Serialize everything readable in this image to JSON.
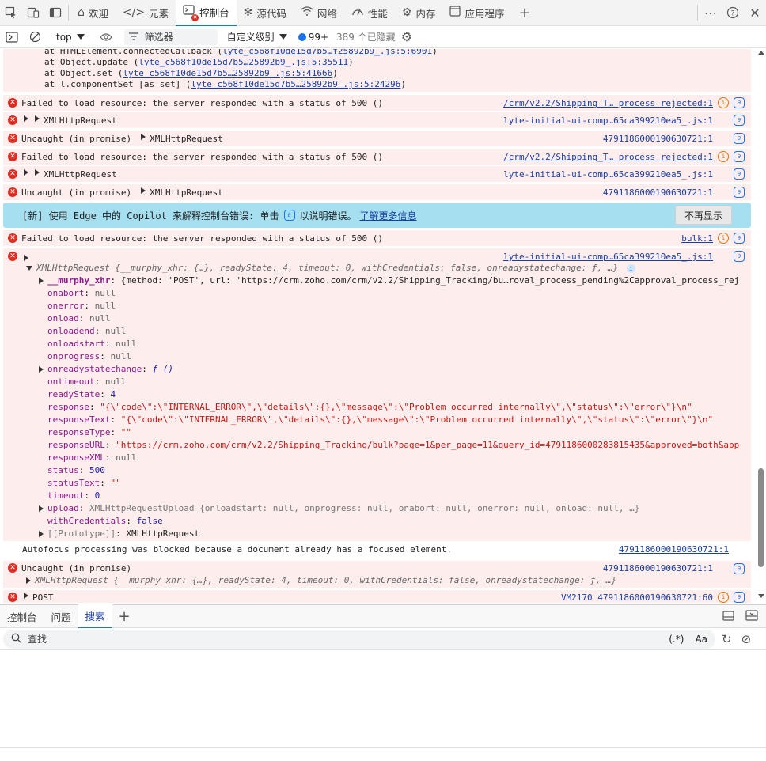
{
  "tabs": [
    {
      "label": "欢迎",
      "icon": "home-icon"
    },
    {
      "label": "元素",
      "icon": "elements-icon"
    },
    {
      "label": "控制台",
      "icon": "console-icon"
    },
    {
      "label": "源代码",
      "icon": "sources-icon"
    },
    {
      "label": "网络",
      "icon": "network-icon"
    },
    {
      "label": "性能",
      "icon": "performance-icon"
    },
    {
      "label": "内存",
      "icon": "memory-icon"
    },
    {
      "label": "应用程序",
      "icon": "application-icon"
    }
  ],
  "toolbar": {
    "context": "top",
    "filter_placeholder": "筛选器",
    "levels": "自定义级别",
    "message_count": "99+",
    "hidden": "389 个已隐藏"
  },
  "stack": [
    {
      "prefix": "at HTMLElement.connectedCallback (",
      "link": "lyte_c568f10de15d7b5…f25892b9_.js:5:6901",
      "suffix": ")"
    },
    {
      "prefix": "at Object.update (",
      "link": "lyte_c568f10de15d7b5…25892b9_.js:5:35511",
      "suffix": ")"
    },
    {
      "prefix": "at Object.set (",
      "link": "lyte_c568f10de15d7b5…25892b9_.js:5:41666",
      "suffix": ")"
    },
    {
      "prefix": "at l.componentSet [as set] (",
      "link": "lyte_c568f10de15d7b5…25892b9_.js:5:24296",
      "suffix": ")"
    }
  ],
  "messages": {
    "m1": {
      "text": "Failed to load resource: the server responded with a status of 500 ()",
      "src": "/crm/v2.2/Shipping_T… process rejected:1"
    },
    "m2": {
      "text": "XMLHttpRequest",
      "src": "lyte-initial-ui-comp…65ca399210ea5_.js:1"
    },
    "m3": {
      "text": "Uncaught (in promise)",
      "obj": "XMLHttpRequest",
      "src": "4791186000190630721:1"
    },
    "m4": {
      "text": "Failed to load resource: the server responded with a status of 500 ()",
      "src": "/crm/v2.2/Shipping_T… process rejected:1"
    },
    "m5": {
      "text": "XMLHttpRequest",
      "src": "lyte-initial-ui-comp…65ca399210ea5_.js:1"
    },
    "m6": {
      "text": "Uncaught (in promise)",
      "obj": "XMLHttpRequest",
      "src": "4791186000190630721:1"
    },
    "m7": {
      "text": "Failed to load resource: the server responded with a status of 500 ()",
      "src": "bulk:1"
    },
    "m8": {
      "src": "lyte-initial-ui-comp…65ca399210ea5_.js:1"
    },
    "m9": {
      "text": "Autofocus processing was blocked because a document already has a focused element.",
      "src": "4791186000190630721:1"
    },
    "m10": {
      "text": "Uncaught (in promise)",
      "src": "4791186000190630721:1",
      "sub": "XMLHttpRequest {__murphy_xhr: {…}, readyState: 4, timeout: 0, withCredentials: false, onreadystatechange: ƒ, …}"
    },
    "m11": {
      "text": "POST",
      "src": "VM2170 4791186000190630721:60"
    }
  },
  "copilot": {
    "text": "[新] 使用 Edge 中的 Copilot 来解释控制台错误: 单击",
    "text2": "以说明错误。",
    "link": "了解更多信息",
    "button": "不再显示"
  },
  "xhr": {
    "summary": "XMLHttpRequest {__murphy_xhr: {…}, readyState: 4, timeout: 0, withCredentials: false, onreadystatechange: ƒ, …}",
    "murphy_key": "__murphy_xhr",
    "murphy_val": "{method: 'POST', url: 'https://crm.zoho.com/crm/v2.2/Shipping_Tracking/bu…roval_process_pending%2Capproval_process_rej",
    "props": [
      {
        "k": "onabort",
        "v": "null",
        "t": "null"
      },
      {
        "k": "onerror",
        "v": "null",
        "t": "null"
      },
      {
        "k": "onload",
        "v": "null",
        "t": "null"
      },
      {
        "k": "onloadend",
        "v": "null",
        "t": "null"
      },
      {
        "k": "onloadstart",
        "v": "null",
        "t": "null"
      },
      {
        "k": "onprogress",
        "v": "null",
        "t": "null"
      }
    ],
    "onreadystatechange": "ƒ ()",
    "ontimeout": "null",
    "readyState": "4",
    "response": "\"{\\\"code\\\":\\\"INTERNAL_ERROR\\\",\\\"details\\\":{},\\\"message\\\":\\\"Problem occurred internally\\\",\\\"status\\\":\\\"error\\\"}\\n\"",
    "responseText": "\"{\\\"code\\\":\\\"INTERNAL_ERROR\\\",\\\"details\\\":{},\\\"message\\\":\\\"Problem occurred internally\\\",\\\"status\\\":\\\"error\\\"}\\n\"",
    "responseType": "\"\"",
    "responseURL": "\"https://crm.zoho.com/crm/v2.2/Shipping_Tracking/bulk?page=1&per_page=11&query_id=4791186000283815435&approved=both&app",
    "responseXML": "null",
    "status": "500",
    "statusText": "\"\"",
    "timeout": "0",
    "upload": "XMLHttpRequestUpload {onloadstart: null, onprogress: null, onabort: null, onerror: null, onload: null, …}",
    "withCredentials": "false",
    "prototype": "XMLHttpRequest"
  },
  "drawer": {
    "tabs": [
      "控制台",
      "问题",
      "搜索"
    ],
    "search_placeholder": "查找",
    "regex": "(.*)",
    "case": "Aa"
  }
}
